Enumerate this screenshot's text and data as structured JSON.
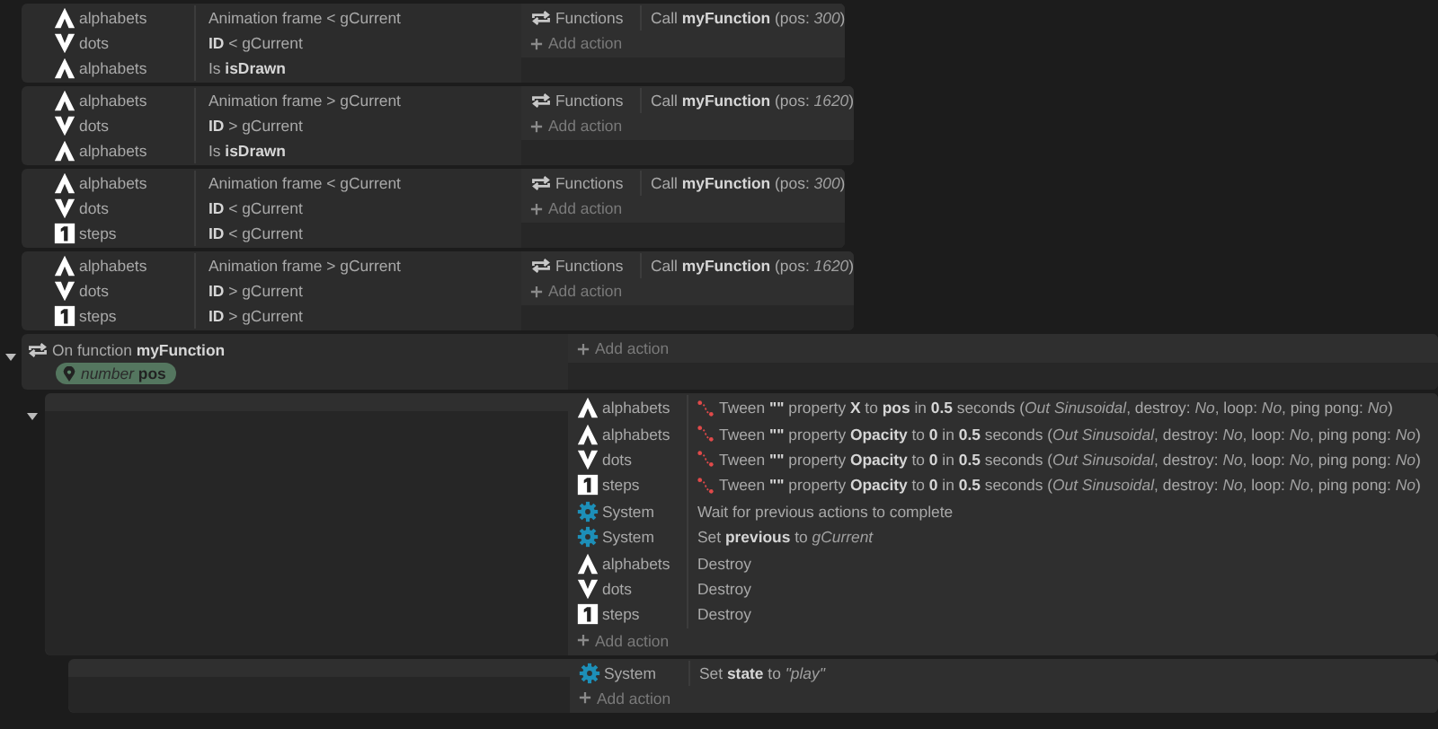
{
  "events": [
    {
      "conditions": [
        {
          "object": "alphabets",
          "kind": "letter",
          "text": "Animation frame < gCurrent"
        },
        {
          "object": "dots",
          "kind": "chevron",
          "text": "**ID** < gCurrent"
        },
        {
          "object": "alphabets",
          "kind": "letter",
          "text": "Is **isDrawn**"
        }
      ],
      "actions": [
        {
          "object": "Functions",
          "kind": "function",
          "text": "Call **myFunction** (pos: *300*)"
        }
      ],
      "add_action": "Add action"
    },
    {
      "conditions": [
        {
          "object": "alphabets",
          "kind": "letter",
          "text": "Animation frame > gCurrent"
        },
        {
          "object": "dots",
          "kind": "chevron",
          "text": "**ID** > gCurrent"
        },
        {
          "object": "alphabets",
          "kind": "letter",
          "text": "Is **isDrawn**"
        }
      ],
      "actions": [
        {
          "object": "Functions",
          "kind": "function",
          "text": "Call **myFunction** (pos: *1620*)"
        }
      ],
      "add_action": "Add action"
    },
    {
      "conditions": [
        {
          "object": "alphabets",
          "kind": "letter",
          "text": "Animation frame < gCurrent"
        },
        {
          "object": "dots",
          "kind": "chevron",
          "text": "**ID** < gCurrent"
        },
        {
          "object": "steps",
          "kind": "tile",
          "text": "**ID** < gCurrent"
        }
      ],
      "actions": [
        {
          "object": "Functions",
          "kind": "function",
          "text": "Call **myFunction** (pos: *300*)"
        }
      ],
      "add_action": "Add action"
    },
    {
      "conditions": [
        {
          "object": "alphabets",
          "kind": "letter",
          "text": "Animation frame > gCurrent"
        },
        {
          "object": "dots",
          "kind": "chevron",
          "text": "**ID** > gCurrent"
        },
        {
          "object": "steps",
          "kind": "tile",
          "text": "**ID** > gCurrent"
        }
      ],
      "actions": [
        {
          "object": "Functions",
          "kind": "function",
          "text": "Call **myFunction** (pos: *1620*)"
        }
      ],
      "add_action": "Add action"
    }
  ],
  "function_block": {
    "expanded": true,
    "title": "On function **myFunction**",
    "parameter": {
      "type": "number",
      "name": "pos"
    },
    "add_action": "Add action",
    "sub_events": [
      {
        "expanded": true,
        "actions": [
          {
            "object": "alphabets",
            "kind": "lettertween",
            "text": "Tween **\"\"** property **X** to **pos** in **0.5** seconds (*Out Sinusoidal*, destroy: *No*, loop: *No*, ping pong: *No*)"
          },
          {
            "object": "alphabets",
            "kind": "lettertween",
            "text": "Tween **\"\"** property **Opacity** to **0** in **0.5** seconds (*Out Sinusoidal*, destroy: *No*, loop: *No*, ping pong: *No*)"
          },
          {
            "object": "dots",
            "kind": "chevrontween",
            "text": "Tween **\"\"** property **Opacity** to **0** in **0.5** seconds (*Out Sinusoidal*, destroy: *No*, loop: *No*, ping pong: *No*)"
          },
          {
            "object": "steps",
            "kind": "tiletween",
            "text": "Tween **\"\"** property **Opacity** to **0** in **0.5** seconds (*Out Sinusoidal*, destroy: *No*, loop: *No*, ping pong: *No*)"
          },
          {
            "object": "System",
            "kind": "system",
            "text": "Wait for previous actions to complete"
          },
          {
            "object": "System",
            "kind": "system",
            "text": "Set **previous** to *gCurrent*"
          },
          {
            "object": "alphabets",
            "kind": "letter",
            "text": "Destroy"
          },
          {
            "object": "dots",
            "kind": "chevron",
            "text": "Destroy"
          },
          {
            "object": "steps",
            "kind": "tile",
            "text": "Destroy"
          }
        ],
        "add_action": "Add action",
        "sub_events": [
          {
            "actions": [
              {
                "object": "System",
                "kind": "system",
                "text": "Set **state** to *\"play\"*"
              }
            ],
            "add_action": "Add action"
          }
        ]
      }
    ]
  }
}
